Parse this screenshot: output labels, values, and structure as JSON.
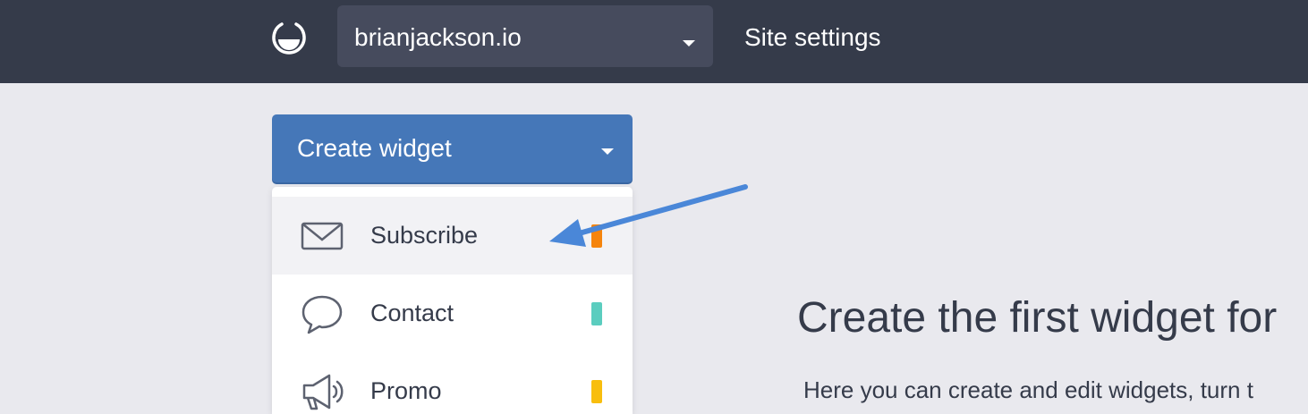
{
  "header": {
    "logo_icon": "hustle-logo-icon",
    "site_selector": {
      "value": "brianjackson.io",
      "icon": "chevron-down-icon"
    },
    "site_settings_label": "Site settings"
  },
  "create_widget": {
    "label": "Create widget",
    "icon": "chevron-down-icon",
    "color": "#4577b8"
  },
  "menu": {
    "items": [
      {
        "label": "Subscribe",
        "icon": "envelope-icon",
        "color": "#f5840c",
        "highlighted": true
      },
      {
        "label": "Contact",
        "icon": "speech-bubble-icon",
        "color": "#5bcdbf",
        "highlighted": false
      },
      {
        "label": "Promo",
        "icon": "megaphone-icon",
        "color": "#f8be0e",
        "highlighted": false
      }
    ]
  },
  "annotation": {
    "arrow_color": "#4a87d8"
  },
  "empty_state": {
    "title": "Create the first widget for",
    "description": "Here you can create and edit widgets, turn t"
  }
}
